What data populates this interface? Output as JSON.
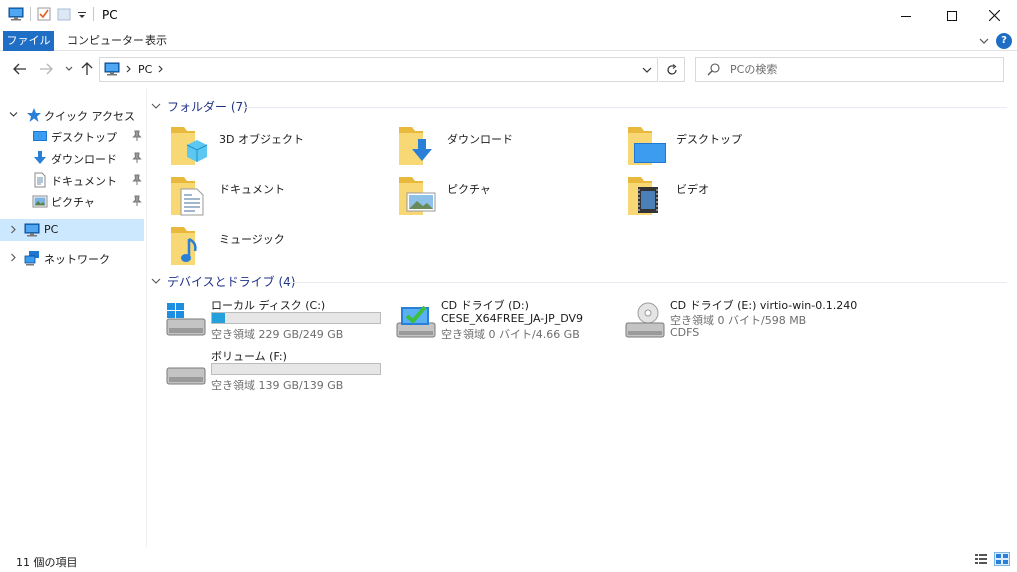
{
  "window": {
    "title": "PC",
    "minimize_glyph": "—",
    "maximize_glyph": "☐",
    "close_glyph": "✕"
  },
  "ribbon": {
    "tabs": [
      "ファイル",
      "コンピューター",
      "表示"
    ],
    "help_glyph": "?"
  },
  "address": {
    "crumbs": [
      "PC"
    ]
  },
  "search": {
    "placeholder": "PCの検索"
  },
  "sidebar": {
    "quick_access": "クイック アクセス",
    "items": [
      {
        "label": "デスクトップ",
        "icon": "desktop-icon"
      },
      {
        "label": "ダウンロード",
        "icon": "download-icon"
      },
      {
        "label": "ドキュメント",
        "icon": "documents-icon"
      },
      {
        "label": "ピクチャ",
        "icon": "pictures-icon"
      }
    ],
    "pc": "PC",
    "network": "ネットワーク"
  },
  "folders_group": {
    "title": "フォルダー (7)",
    "items": [
      {
        "label": "3D オブジェクト",
        "icon": "3d-objects-folder-icon"
      },
      {
        "label": "ダウンロード",
        "icon": "downloads-folder-icon"
      },
      {
        "label": "デスクトップ",
        "icon": "desktop-folder-icon"
      },
      {
        "label": "ドキュメント",
        "icon": "documents-folder-icon"
      },
      {
        "label": "ピクチャ",
        "icon": "pictures-folder-icon"
      },
      {
        "label": "ビデオ",
        "icon": "videos-folder-icon"
      },
      {
        "label": "ミュージック",
        "icon": "music-folder-icon"
      }
    ]
  },
  "drives_group": {
    "title": "デバイスとドライブ (4)",
    "items": [
      {
        "name": "ローカル ディスク (C:)",
        "free": "空き領域 229 GB/249 GB",
        "used_fraction": 0.08,
        "icon": "windows-drive-icon"
      },
      {
        "name": "CD ドライブ (D:)",
        "label": "CESE_X64FREE_JA-JP_DV9",
        "free": "空き領域 0 バイト/4.66 GB",
        "icon": "dvd-setup-drive-icon"
      },
      {
        "name": "CD ドライブ (E:) virtio-win-0.1.240",
        "free": "空き領域 0 バイト/598 MB",
        "fs": "CDFS",
        "icon": "cd-drive-icon"
      },
      {
        "name": "ボリューム (F:)",
        "free": "空き領域 139 GB/139 GB",
        "used_fraction": 0.0,
        "icon": "hard-drive-icon"
      }
    ]
  },
  "status": {
    "count": "11 個の項目"
  },
  "colors": {
    "accent": "#1e6ec6",
    "selection": "#cce8ff",
    "group_title": "#1e3287",
    "folder": "#f8d775",
    "progress": "#26a0da"
  }
}
